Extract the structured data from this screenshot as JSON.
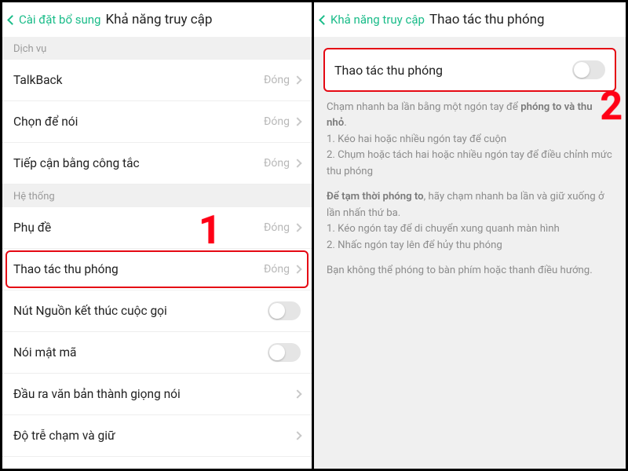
{
  "annotations": {
    "num1": "1",
    "num2": "2"
  },
  "left": {
    "back_label": "Cài đặt bổ sung",
    "title": "Khả năng truy cập",
    "section_service": "Dịch vụ",
    "section_system": "Hệ thống",
    "closed": "Đóng",
    "items_service": [
      {
        "label": "TalkBack"
      },
      {
        "label": "Chọn để nói"
      },
      {
        "label": "Tiếp cận bằng công tắc"
      }
    ],
    "items_system": [
      {
        "label": "Phụ đề",
        "type": "link"
      },
      {
        "label": "Thao tác thu phóng",
        "type": "link",
        "highlight": true
      },
      {
        "label": "Nút Nguồn kết thúc cuộc gọi",
        "type": "toggle"
      },
      {
        "label": "Nói mật mã",
        "type": "toggle"
      },
      {
        "label": "Đầu ra văn bản thành giọng nói",
        "type": "link_plain"
      },
      {
        "label": "Độ trễ chạm và giữ",
        "type": "link_plain"
      }
    ]
  },
  "right": {
    "back_label": "Khả năng truy cập",
    "title": "Thao tác thu phóng",
    "toggle_label": "Thao tác thu phóng",
    "p1_a": "Chạm nhanh ba lần bằng một ngón tay để ",
    "p1_b": "phóng to và thu nhỏ",
    "p1_c": ".",
    "l1": "1. Kéo hai hoặc nhiều ngón tay để cuộn",
    "l2": "2. Chụm hoặc tách hai hoặc nhiều ngón tay để điều chỉnh mức thu phóng",
    "p2_a": "Để tạm thời phóng to",
    "p2_b": ", hãy chạm nhanh ba lần và giữ xuống ở lần nhấn thứ ba.",
    "l3": "1. Kéo ngón tay để di chuyển xung quanh màn hình",
    "l4": "2. Nhấc ngón tay lên để hủy thu phóng",
    "p3": "Bạn không thể phóng to bàn phím hoặc thanh điều hướng."
  }
}
